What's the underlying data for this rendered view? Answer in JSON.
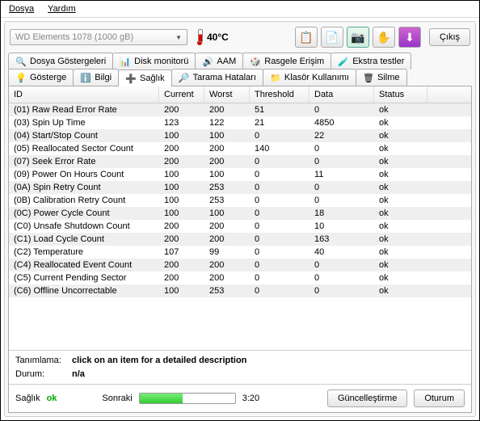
{
  "menu": {
    "file": "Dosya",
    "help": "Yardım"
  },
  "drive": "WD     Elements 1078 (1000 gB)",
  "temperature": "40°C",
  "exit": "Çıkış",
  "tabs_row1": [
    {
      "icon": "🔍",
      "label": "Dosya Göstergeleri"
    },
    {
      "icon": "📊",
      "label": "Disk monitorü"
    },
    {
      "icon": "🔊",
      "label": "AAM"
    },
    {
      "icon": "🎲",
      "label": "Rasgele Erişim"
    },
    {
      "icon": "🧪",
      "label": "Ekstra testler"
    }
  ],
  "tabs_row2": [
    {
      "icon": "💡",
      "label": "Gösterge"
    },
    {
      "icon": "ℹ️",
      "label": "Bilgi"
    },
    {
      "icon": "➕",
      "label": "Sağlık",
      "active": true
    },
    {
      "icon": "🔎",
      "label": "Tarama Hataları"
    },
    {
      "icon": "📁",
      "label": "Klasör Kullanımı"
    },
    {
      "icon": "🗑",
      "label": "Silme"
    }
  ],
  "columns": {
    "id": "ID",
    "current": "Current",
    "worst": "Worst",
    "threshold": "Threshold",
    "data": "Data",
    "status": "Status"
  },
  "rows": [
    {
      "id": "(01) Raw Read Error Rate",
      "cur": "200",
      "wor": "200",
      "thr": "51",
      "dat": "0",
      "sta": "ok"
    },
    {
      "id": "(03) Spin Up Time",
      "cur": "123",
      "wor": "122",
      "thr": "21",
      "dat": "4850",
      "sta": "ok"
    },
    {
      "id": "(04) Start/Stop Count",
      "cur": "100",
      "wor": "100",
      "thr": "0",
      "dat": "22",
      "sta": "ok"
    },
    {
      "id": "(05) Reallocated Sector Count",
      "cur": "200",
      "wor": "200",
      "thr": "140",
      "dat": "0",
      "sta": "ok"
    },
    {
      "id": "(07) Seek Error Rate",
      "cur": "200",
      "wor": "200",
      "thr": "0",
      "dat": "0",
      "sta": "ok"
    },
    {
      "id": "(09) Power On Hours Count",
      "cur": "100",
      "wor": "100",
      "thr": "0",
      "dat": "11",
      "sta": "ok"
    },
    {
      "id": "(0A) Spin Retry Count",
      "cur": "100",
      "wor": "253",
      "thr": "0",
      "dat": "0",
      "sta": "ok"
    },
    {
      "id": "(0B) Calibration Retry Count",
      "cur": "100",
      "wor": "253",
      "thr": "0",
      "dat": "0",
      "sta": "ok"
    },
    {
      "id": "(0C) Power Cycle Count",
      "cur": "100",
      "wor": "100",
      "thr": "0",
      "dat": "18",
      "sta": "ok"
    },
    {
      "id": "(C0) Unsafe Shutdown Count",
      "cur": "200",
      "wor": "200",
      "thr": "0",
      "dat": "10",
      "sta": "ok"
    },
    {
      "id": "(C1) Load Cycle Count",
      "cur": "200",
      "wor": "200",
      "thr": "0",
      "dat": "163",
      "sta": "ok"
    },
    {
      "id": "(C2) Temperature",
      "cur": "107",
      "wor": "99",
      "thr": "0",
      "dat": "40",
      "sta": "ok"
    },
    {
      "id": "(C4) Reallocated Event Count",
      "cur": "200",
      "wor": "200",
      "thr": "0",
      "dat": "0",
      "sta": "ok"
    },
    {
      "id": "(C5) Current Pending Sector",
      "cur": "200",
      "wor": "200",
      "thr": "0",
      "dat": "0",
      "sta": "ok"
    },
    {
      "id": "(C6) Offline Uncorrectable",
      "cur": "100",
      "wor": "253",
      "thr": "0",
      "dat": "0",
      "sta": "ok"
    }
  ],
  "desc": {
    "label1": "Tanımlama:",
    "val1": "click on an item for a detailed description",
    "label2": "Durum:",
    "val2": "n/a"
  },
  "footer": {
    "health_label": "Sağlık",
    "health_val": "ok",
    "next_label": "Sonraki",
    "time": "3:20",
    "update": "Güncelleştirme",
    "session": "Oturum"
  }
}
